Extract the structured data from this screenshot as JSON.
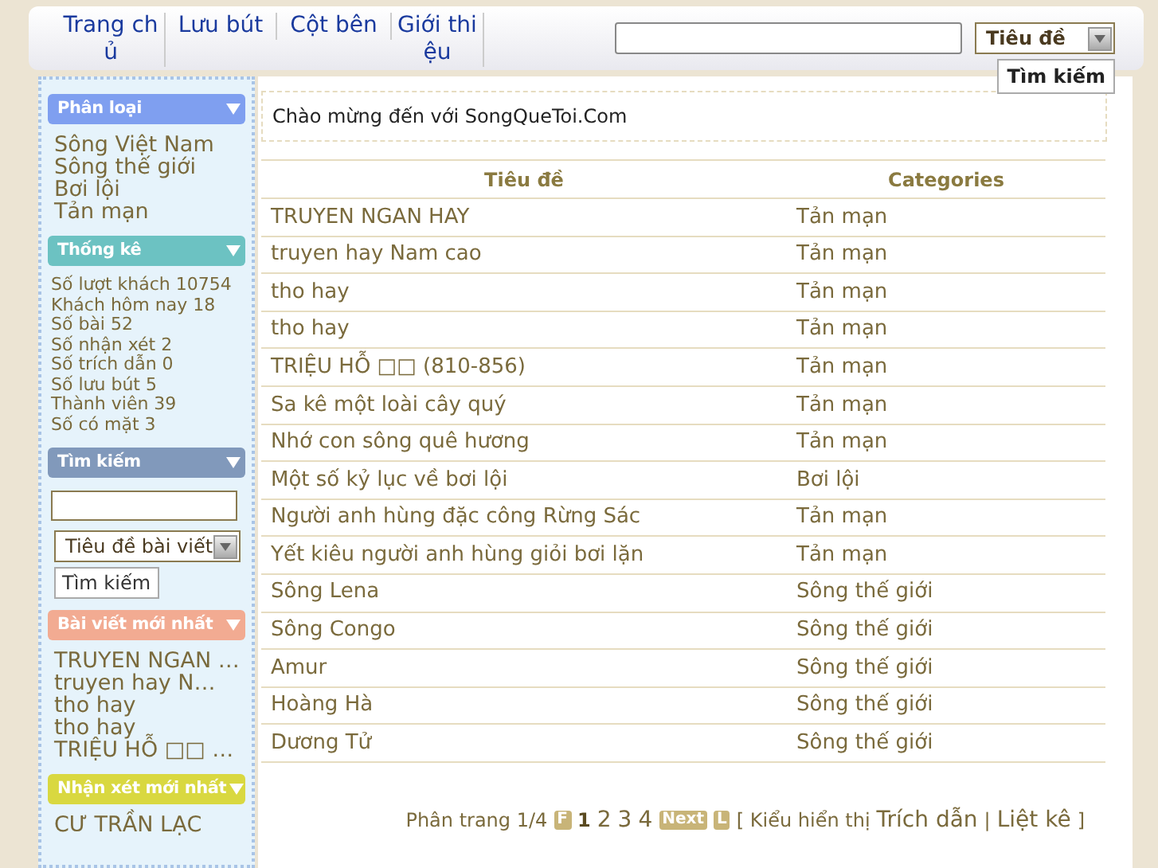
{
  "nav": [
    {
      "label": "Trang chủ"
    },
    {
      "label": "Lưu bút"
    },
    {
      "label": "Cột bên"
    },
    {
      "label": "Giới thiệu"
    }
  ],
  "header_search": {
    "select": "Tiêu đề",
    "button": "Tìm kiếm"
  },
  "sidebar": [
    {
      "kind": "links",
      "title": "Phân loại",
      "color": "#7f9ff0",
      "items": [
        "Sông Việt Nam",
        "Sông thế giới",
        "Bơi lội",
        "Tản mạn"
      ]
    },
    {
      "kind": "stats",
      "title": "Thống kê",
      "color": "#6cc2c2",
      "items": [
        "Số lượt khách 10754",
        "Khách hôm nay 18",
        "Số bài 52",
        "Số nhận xét 2",
        "Số trích dẫn 0",
        "Số lưu bút 5",
        "Thành viên 39",
        "Số có mặt 3"
      ]
    },
    {
      "kind": "search",
      "title": "Tìm kiếm",
      "color": "#8199bb",
      "select": "Tiêu đề bài viết",
      "button": "Tìm kiếm"
    },
    {
      "kind": "links",
      "title": "Bài viết mới nhất",
      "color": "#f2ab92",
      "items": [
        "TRUYEN NGAN …",
        "truyen hay N…",
        "tho hay",
        "tho hay",
        "TRIỆU HỖ □□ …"
      ]
    },
    {
      "kind": "links",
      "title": "Nhận xét mới nhất",
      "color": "#d9d840",
      "items": [
        "CƯ TRẦN LẠC"
      ]
    }
  ],
  "welcome": "Chào mừng đến với SongQueToi.Com",
  "table": {
    "columns": [
      "Tiêu đề",
      "Categories"
    ],
    "rows": [
      [
        "TRUYEN NGAN HAY",
        "Tản mạn"
      ],
      [
        "truyen hay Nam cao",
        "Tản mạn"
      ],
      [
        "tho hay",
        "Tản mạn"
      ],
      [
        "tho hay",
        "Tản mạn"
      ],
      [
        "TRIỆU HỖ □□ (810-856)",
        "Tản mạn"
      ],
      [
        "Sa kê một loài cây quý",
        "Tản mạn"
      ],
      [
        "Nhớ con sông quê hương",
        "Tản mạn"
      ],
      [
        "Một số kỷ lục về bơi lội",
        "Bơi lội"
      ],
      [
        "Người anh hùng đặc công Rừng Sác",
        "Tản mạn"
      ],
      [
        "Yết kiêu người anh hùng giỏi bơi lặn",
        "Tản mạn"
      ],
      [
        "Sông Lena",
        "Sông thế giới"
      ],
      [
        "Sông Congo",
        "Sông thế giới"
      ],
      [
        "Amur",
        "Sông thế giới"
      ],
      [
        "Hoàng Hà",
        "Sông thế giới"
      ],
      [
        "Dương Tử",
        "Sông thế giới"
      ]
    ]
  },
  "pagination": {
    "label": "Phân trang 1/4",
    "first": "F",
    "pages": [
      {
        "label": "1",
        "selected": true
      },
      {
        "label": "2",
        "selected": false
      },
      {
        "label": "3",
        "selected": false
      },
      {
        "label": "4",
        "selected": false
      }
    ],
    "next": "Next",
    "last": "L",
    "view_label": "[ Kiểu hiển thị",
    "views": [
      "Trích dẫn",
      "Liệt kê"
    ],
    "separator": "|",
    "end": "]"
  }
}
